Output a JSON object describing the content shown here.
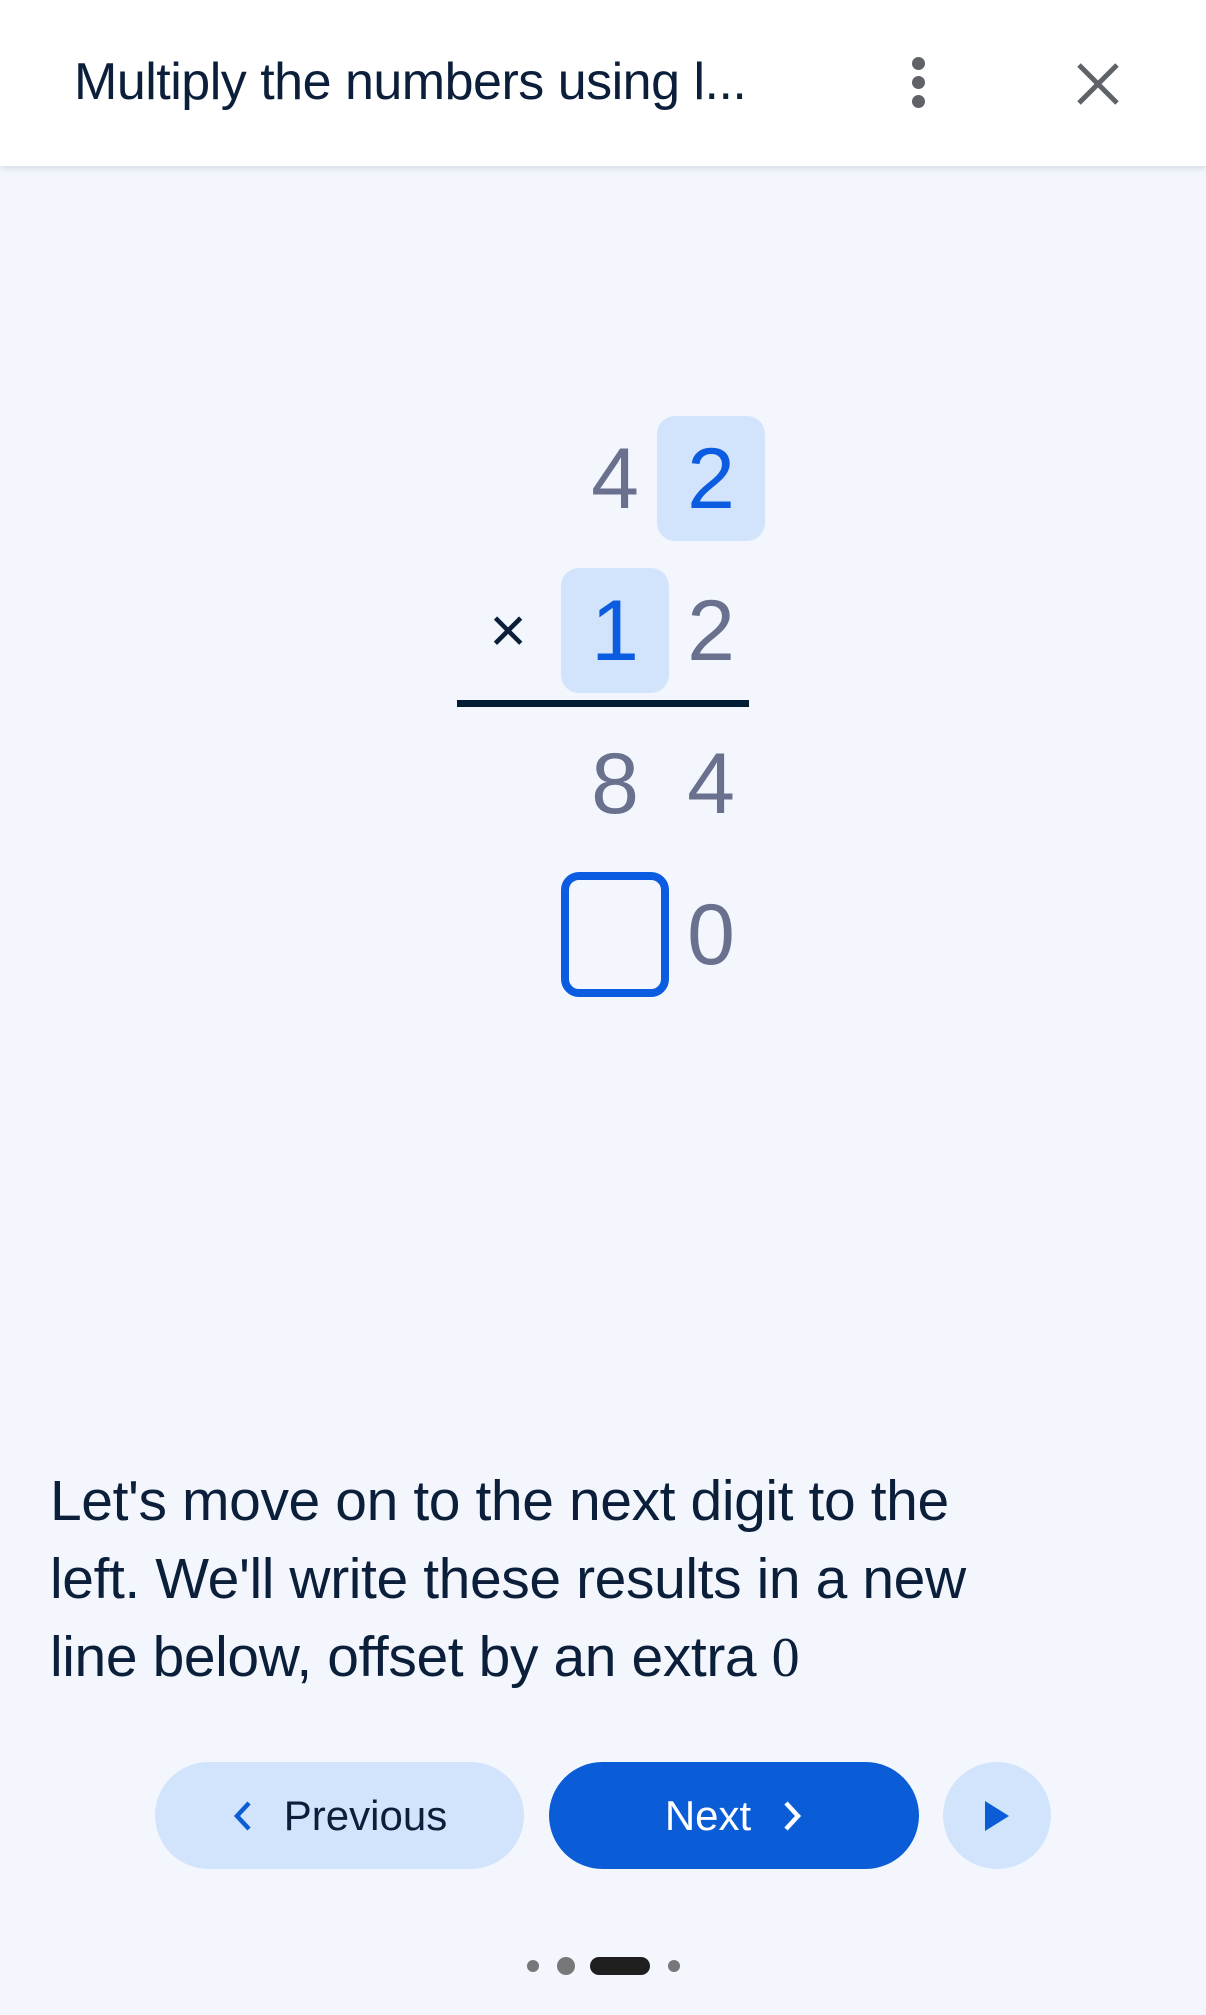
{
  "header": {
    "title": "Multiply the numbers using l...",
    "more_icon": "more-vert-icon",
    "close_icon": "close-icon"
  },
  "problem": {
    "multiplicand": [
      "4",
      "2"
    ],
    "operator": "×",
    "multiplier": [
      "1",
      "2"
    ],
    "partial_product_1": [
      "8",
      "4"
    ],
    "partial_product_2": {
      "input_value": "",
      "placeholder": "",
      "trailing_digit": "0"
    },
    "highlighted": {
      "multiplicand_digit": "2",
      "multiplier_digit": "1"
    }
  },
  "instruction": {
    "lines": [
      "Let's move on to the next digit to the",
      "left. We'll write these results in a new",
      "line below, offset by an extra "
    ],
    "math_zero": "0"
  },
  "controls": {
    "previous_label": "Previous",
    "next_label": "Next",
    "play_icon": "play-icon"
  },
  "pagination": {
    "total": 4,
    "current": 3
  },
  "colors": {
    "accent": "#0b5cd7",
    "highlight_bg": "#d2e3fc",
    "digit": "#69718f",
    "text": "#0b1f3a",
    "background": "#f3f7fd"
  }
}
